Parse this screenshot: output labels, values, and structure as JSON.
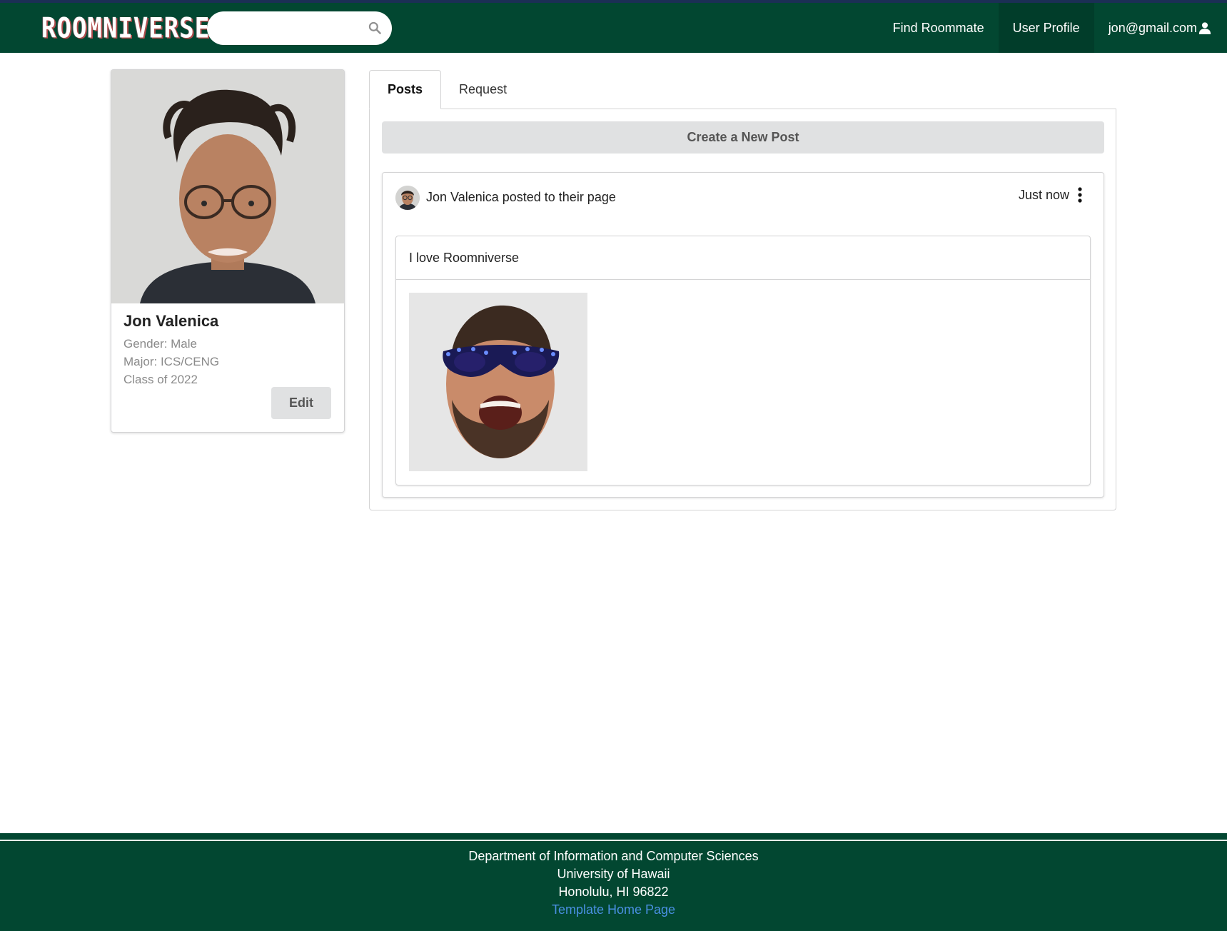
{
  "navbar": {
    "logo_text": "ROOMNIVERSE",
    "search": {
      "placeholder": "",
      "value": ""
    },
    "links": {
      "find_roommate": "Find Roommate",
      "user_profile": "User Profile",
      "user_email": "jon@gmail.com"
    },
    "icons": {
      "search": "search-icon",
      "user": "user-icon"
    }
  },
  "profile": {
    "name": "Jon Valenica",
    "gender": "Gender: Male",
    "major": "Major: ICS/CENG",
    "class_year": "Class of 2022",
    "edit_label": "Edit"
  },
  "tabs": [
    {
      "label": "Posts",
      "active": true
    },
    {
      "label": "Request",
      "active": false
    }
  ],
  "posts_panel": {
    "create_post_label": "Create a New Post",
    "posts": [
      {
        "author_line": "Jon Valenica posted to their page",
        "time": "Just now",
        "text": "I love Roomniverse"
      }
    ]
  },
  "footer": {
    "line1": "Department of Information and Computer Sciences",
    "line2": "University of Hawaii",
    "line3": "Honolulu, HI 96822",
    "link_text": "Template Home Page"
  },
  "colors": {
    "nav_bg": "#024731",
    "footer_bg": "#024731",
    "button_bg": "#e0e1e2",
    "link": "#4a90e2"
  }
}
